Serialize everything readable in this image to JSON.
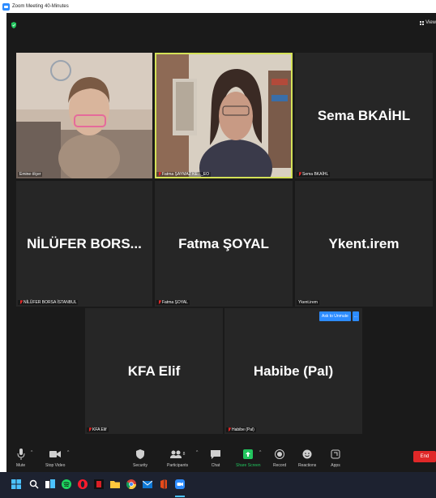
{
  "window": {
    "title": "Zoom Meeting 40-Minutes"
  },
  "header": {
    "view_label": "View"
  },
  "participants": [
    {
      "name": "Emine ölçer",
      "display": "",
      "video_on": true,
      "muted": false
    },
    {
      "name": "Fatma ŞAYMAZ KE..._EO",
      "display": "",
      "video_on": true,
      "muted": true,
      "active_speaker": true
    },
    {
      "name": "Sema BKAİHL",
      "display": "Sema BKAİHL",
      "video_on": false,
      "muted": true
    },
    {
      "name": "NİLÜFER BORSA İSTANBUL",
      "display": "NİLÜFER  BORS...",
      "video_on": false,
      "muted": true
    },
    {
      "name": "Fatma ŞOYAL",
      "display": "Fatma ŞOYAL",
      "video_on": false,
      "muted": true
    },
    {
      "name": "Ykent.irem",
      "display": "Ykent.irem",
      "video_on": false,
      "muted": false
    },
    {
      "name": "KFA Elif",
      "display": "KFA Elif",
      "video_on": false,
      "muted": true
    },
    {
      "name": "Habibe (Pal)",
      "display": "Habibe (Pal)",
      "video_on": false,
      "muted": true
    }
  ],
  "ask_unmute": {
    "label": "Ask to Unmute",
    "more": "..."
  },
  "toolbar": {
    "mute": "Mute",
    "stop_video": "Stop Video",
    "security": "Security",
    "participants": "Participants",
    "participants_count": "8",
    "chat": "Chat",
    "share_screen": "Share Screen",
    "record": "Record",
    "reactions": "Reactions",
    "apps": "Apps",
    "end": "End"
  },
  "colors": {
    "accent": "#2d8cff",
    "share_green": "#22c55e",
    "end_red": "#e02828",
    "active_speaker": "#d4e157",
    "meeting_bg": "#1a1a1a",
    "tile_bg": "#262626",
    "taskbar_bg": "#1d2230"
  },
  "taskbar_icons": [
    "windows-icon",
    "search-icon",
    "task-view-icon",
    "explorer-icon",
    "spotify-icon",
    "opera-icon",
    "red-app-icon",
    "file-explorer-icon",
    "chrome-icon",
    "mail-icon",
    "office-icon",
    "zoom-icon"
  ]
}
